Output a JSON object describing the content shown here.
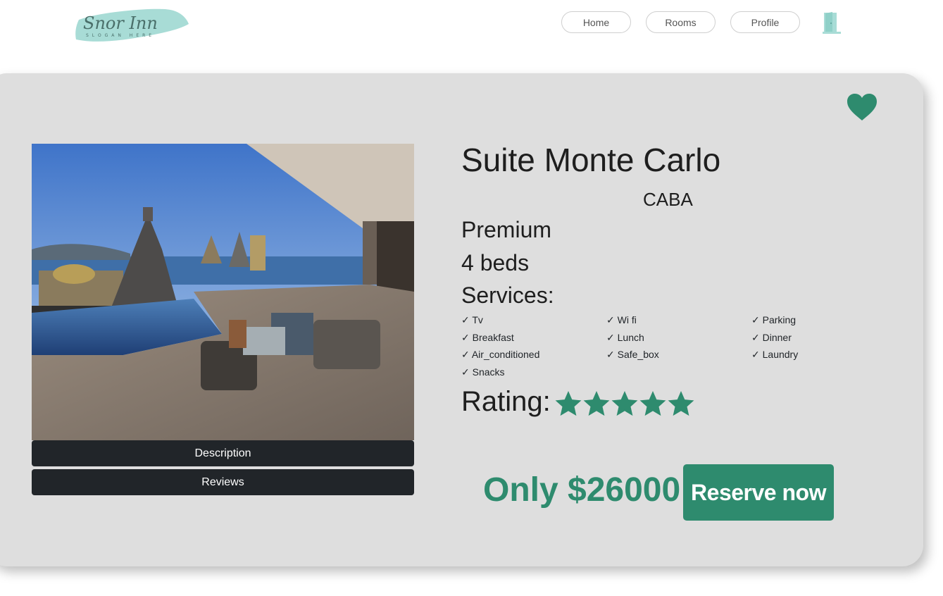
{
  "header": {
    "logo_text": "Snor Inn",
    "logo_slogan": "SLOGAN HERE",
    "nav": {
      "home": "Home",
      "rooms": "Rooms",
      "profile": "Profile"
    },
    "logout_icon": "door-icon"
  },
  "room": {
    "name": "Suite Monte Carlo",
    "city": "CABA",
    "category": "Premium",
    "beds": "4 beds",
    "services_label": "Services:",
    "services": [
      "✓ Tv",
      "✓ Wi fi",
      "✓ Parking",
      "✓ Breakfast",
      "✓ Lunch",
      "✓ Dinner",
      "✓ Air_conditioned",
      "✓ Safe_box",
      "✓ Laundry",
      "✓ Snacks"
    ],
    "rating_label": "Rating:",
    "rating": 5,
    "rating_max": 5,
    "price_text": "Only $26000",
    "reserve_label": "Reserve now",
    "description_label": "Description",
    "reviews_label": "Reviews",
    "favorite_icon": "heart-icon"
  },
  "colors": {
    "accent": "#2e8b6e",
    "card_bg": "#dedede",
    "dark_button": "#212529",
    "logo_brush": "#a8dcd6"
  }
}
